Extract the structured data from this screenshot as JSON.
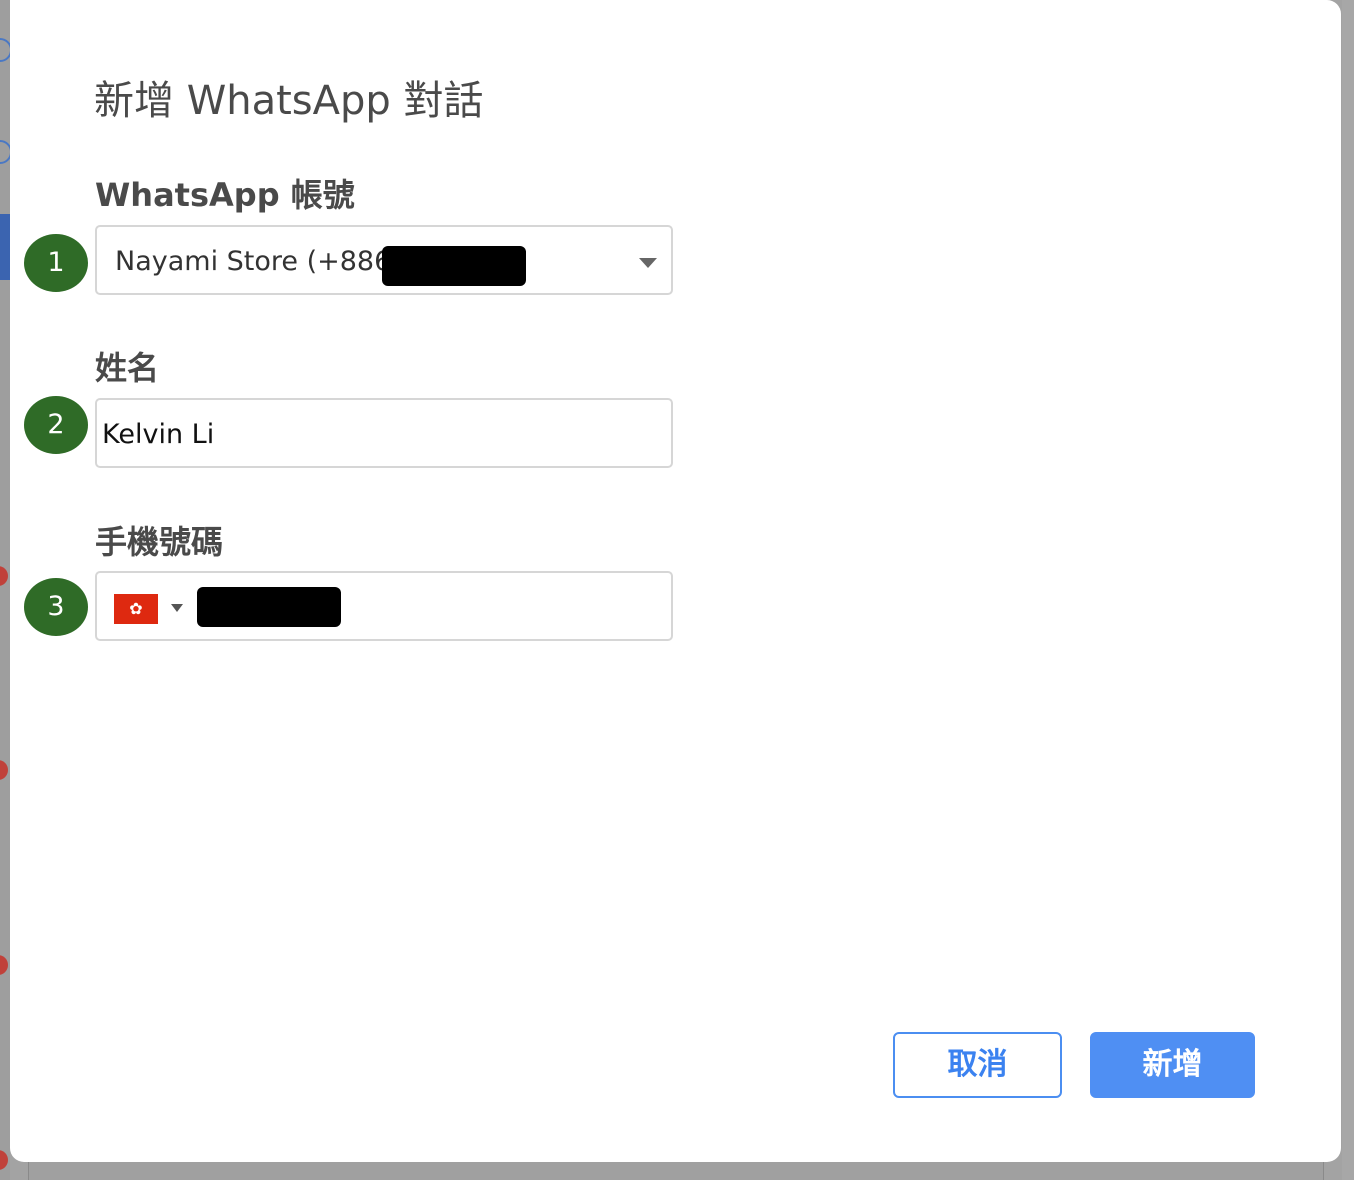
{
  "dialog": {
    "title": "新增 WhatsApp 對話"
  },
  "fields": {
    "account": {
      "label": "WhatsApp 帳號",
      "selected_value": "Nayami Store (+886",
      "step": "1"
    },
    "name": {
      "label": "姓名",
      "value": "Kelvin Li",
      "step": "2"
    },
    "phone": {
      "label": "手機號碼",
      "country_flag": "✿",
      "step": "3"
    }
  },
  "actions": {
    "cancel_label": "取消",
    "add_label": "新增"
  },
  "colors": {
    "primary": "#4f8ff3",
    "step_badge": "#2f6b27",
    "flag_red": "#de2910"
  }
}
